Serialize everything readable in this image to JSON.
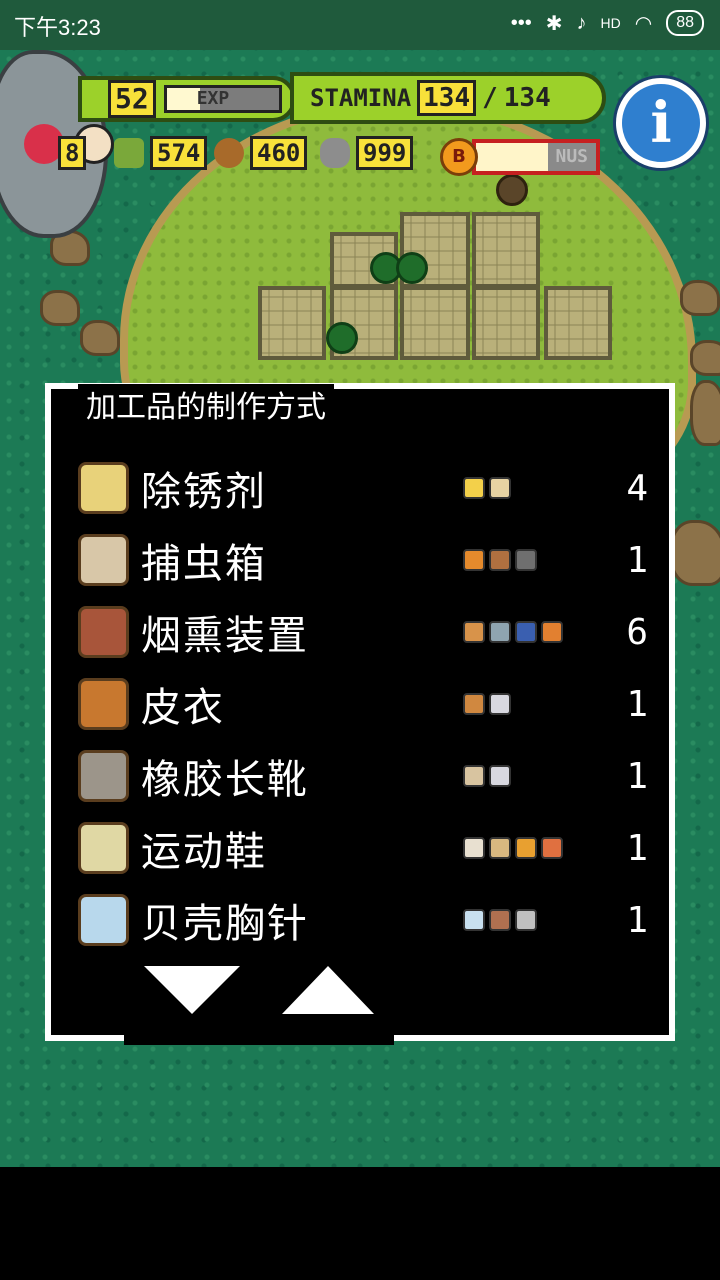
{
  "status_bar": {
    "time": "下午3:23",
    "network": "HD",
    "battery": "88"
  },
  "hud": {
    "level": "52",
    "exp_label": "EXP",
    "exp_progress": 0.3,
    "stamina_label": "STAMINA",
    "stamina_current": "134",
    "stamina_separator": "/",
    "stamina_max": "134",
    "resource_partial": "8",
    "resource_1": "574",
    "resource_2": "460",
    "resource_3": "999",
    "bonus_badge": "B",
    "bonus_label": "NUS",
    "bonus_progress": 0.6,
    "info_label": "i"
  },
  "dialog": {
    "title": "加工品的制作方式",
    "recipes": [
      {
        "name": "除锈剂",
        "qty": "4",
        "icon": "rust-remover-icon",
        "color": "#e8d27a"
      },
      {
        "name": "捕虫箱",
        "qty": "1",
        "icon": "bug-box-icon",
        "color": "#d8c7a8"
      },
      {
        "name": "烟熏装置",
        "qty": "6",
        "icon": "smoker-icon",
        "color": "#a8553a"
      },
      {
        "name": "皮衣",
        "qty": "1",
        "icon": "leather-coat-icon",
        "color": "#c8782f"
      },
      {
        "name": "橡胶长靴",
        "qty": "1",
        "icon": "rubber-boots-icon",
        "color": "#9c958a"
      },
      {
        "name": "运动鞋",
        "qty": "1",
        "icon": "sneakers-icon",
        "color": "#e0d8a4"
      },
      {
        "name": "贝壳胸针",
        "qty": "1",
        "icon": "shell-brooch-icon",
        "color": "#b8d8ec"
      }
    ],
    "scroll_down": "down-arrow-icon",
    "scroll_up": "up-arrow-icon"
  },
  "colors": {
    "hud_green": "#9cd12a",
    "value_yellow": "#f8e13a",
    "bonus_red": "#c62020",
    "info_blue": "#2f7fcf"
  }
}
